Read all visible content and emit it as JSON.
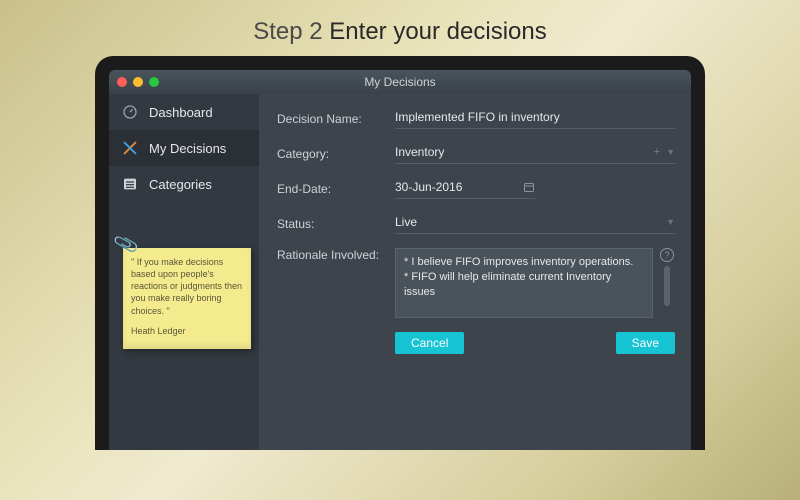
{
  "hero": {
    "step_prefix": "Step 2 ",
    "step_title": "Enter your decisions"
  },
  "window": {
    "title": "My Decisions"
  },
  "sidebar": {
    "items": [
      {
        "label": "Dashboard",
        "icon": "gauge-icon",
        "active": false
      },
      {
        "label": "My Decisions",
        "icon": "cross-tools-icon",
        "active": true
      },
      {
        "label": "Categories",
        "icon": "list-icon",
        "active": false
      }
    ]
  },
  "sticky": {
    "quote": "\" If you make decisions based upon people's reactions or judgments then you make really boring choices. \"",
    "attribution": "Heath Ledger"
  },
  "form": {
    "decision_name": {
      "label": "Decision Name:",
      "value": "Implemented FIFO in inventory"
    },
    "category": {
      "label": "Category:",
      "value": "Inventory"
    },
    "end_date": {
      "label": "End-Date:",
      "value": "30-Jun-2016"
    },
    "status": {
      "label": "Status:",
      "value": "Live"
    },
    "rationale": {
      "label": "Rationale Involved:",
      "value": "* I believe FIFO improves inventory operations.\n* FIFO will help eliminate current Inventory issues"
    },
    "buttons": {
      "cancel": "Cancel",
      "save": "Save"
    }
  }
}
